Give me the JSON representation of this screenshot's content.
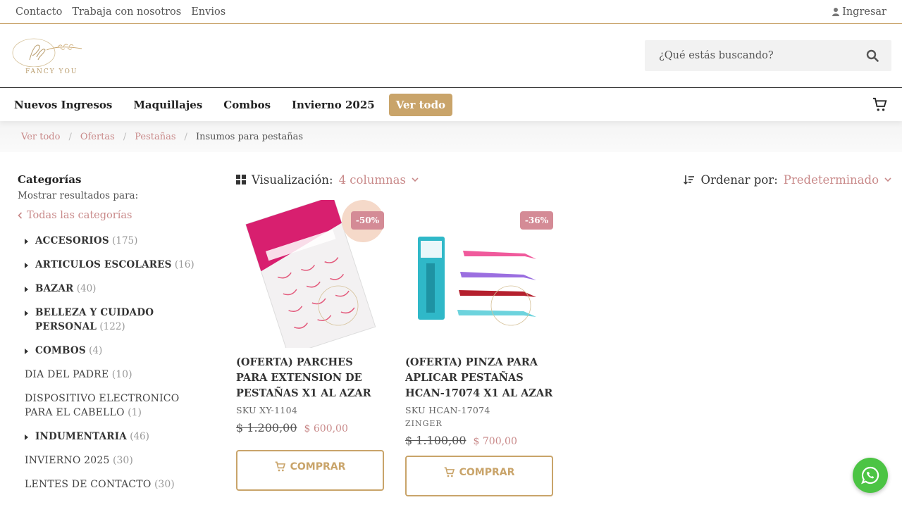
{
  "topbar": {
    "links": [
      "Contacto",
      "Trabaja con nosotros",
      "Envios"
    ],
    "login_label": "Ingresar"
  },
  "header": {
    "logo_text": "FANCY YOU",
    "search_placeholder": "¿Qué estás buscando?"
  },
  "nav": {
    "items": [
      "Nuevos Ingresos",
      "Maquillajes",
      "Combos",
      "Invierno 2025"
    ],
    "highlight": "Ver todo"
  },
  "breadcrumb": {
    "items": [
      "Ver todo",
      "Ofertas",
      "Pestañas"
    ],
    "current": "Insumos para pestañas"
  },
  "sidebar": {
    "title": "Categorías",
    "subtitle": "Mostrar resultados para:",
    "all_link": "Todas las categorías",
    "categories": [
      {
        "name": "ACCESORIOS",
        "count": "(175)"
      },
      {
        "name": "ARTICULOS ESCOLARES",
        "count": "(16)"
      },
      {
        "name": "BAZAR",
        "count": "(40)"
      },
      {
        "name": "BELLEZA Y CUIDADO PERSONAL",
        "count": "(122)"
      },
      {
        "name": "COMBOS",
        "count": "(4)"
      },
      {
        "name": "DIA DEL PADRE",
        "count": "(10)"
      },
      {
        "name": "DISPOSITIVO ELECTRONICO PARA EL CABELLO",
        "count": "(1)"
      },
      {
        "name": "INDUMENTARIA",
        "count": "(46)"
      },
      {
        "name": "INVIERNO 2025",
        "count": "(30)"
      },
      {
        "name": "LENTES DE CONTACTO",
        "count": "(30)"
      }
    ]
  },
  "toolbar": {
    "view_label": "Visualización:",
    "view_value": "4 columnas",
    "sort_label": "Ordenar por:",
    "sort_value": "Predeterminado"
  },
  "products": [
    {
      "badge": "-50%",
      "title": "(OFERTA) PARCHES PARA EXTENSION DE PESTAÑAS X1 AL AZAR",
      "sku": "SKU XY-1104",
      "brand": "",
      "old_price": "$ 1.200,00",
      "new_price": "$ 600,00",
      "buy_label": "COMPRAR"
    },
    {
      "badge": "-36%",
      "title": "(OFERTA) PINZA PARA APLICAR PESTAÑAS HCAN-17074 X1 AL AZAR",
      "sku": "SKU HCAN-17074",
      "brand": "ZINGER",
      "old_price": "$ 1.100,00",
      "new_price": "$ 700,00",
      "buy_label": "COMPRAR"
    }
  ],
  "colors": {
    "gold": "#c9a46a",
    "rose": "#c98a8a",
    "badge": "#d48b96",
    "whatsapp": "#4cc444"
  }
}
